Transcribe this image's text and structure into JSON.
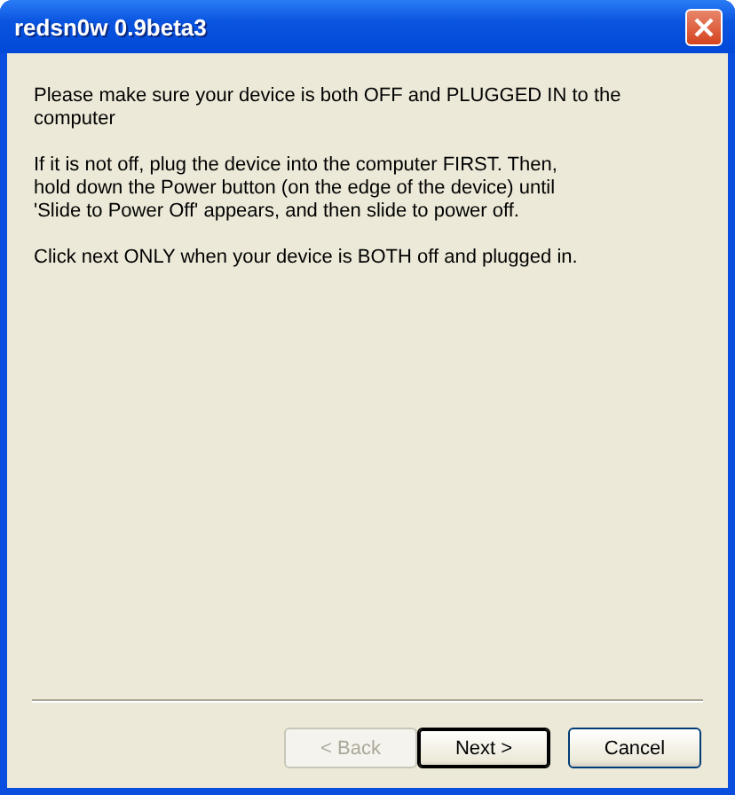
{
  "window": {
    "title": "redsn0w 0.9beta3"
  },
  "paragraphs": [
    {
      "lines": [
        "Please make sure your device is both OFF and PLUGGED IN to the",
        "computer"
      ]
    },
    {
      "lines": [
        "If it is not off, plug the device into the computer FIRST. Then,",
        "hold down the Power button (on the edge of the device) until",
        "'Slide to Power Off' appears, and then slide to power off."
      ]
    },
    {
      "lines": [
        "Click next ONLY when your device is BOTH off and plugged in."
      ]
    }
  ],
  "buttons": [
    {
      "label": "< Back",
      "disabled": true,
      "default": false
    },
    {
      "label": "Next >",
      "disabled": false,
      "default": true
    },
    {
      "label": "Cancel",
      "disabled": false,
      "default": false
    }
  ]
}
